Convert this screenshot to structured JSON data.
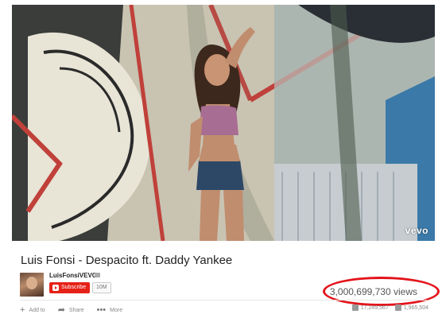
{
  "video": {
    "title": "Luis Fonsi - Despacito ft. Daddy Yankee",
    "watermark": "vevo",
    "views": "3,000,699,730 views"
  },
  "channel": {
    "name": "LuisFonsiVEVO",
    "subscribe_label": "Subscribe",
    "subscriber_count": "10M"
  },
  "actions": {
    "add_to": "Add to",
    "share": "Share",
    "more": "More"
  },
  "likes": {
    "like_count": "17,249,567",
    "dislike_count": "1,965,504"
  },
  "colors": {
    "subscribe": "#e62117",
    "highlight": "#e3141b"
  },
  "icons": {
    "add": "plus-icon",
    "share": "share-arrow-icon",
    "more": "ellipsis-icon",
    "like": "thumbs-up-icon",
    "dislike": "thumbs-down-icon",
    "verified": "verified-icon",
    "youtube": "youtube-logo-icon"
  }
}
